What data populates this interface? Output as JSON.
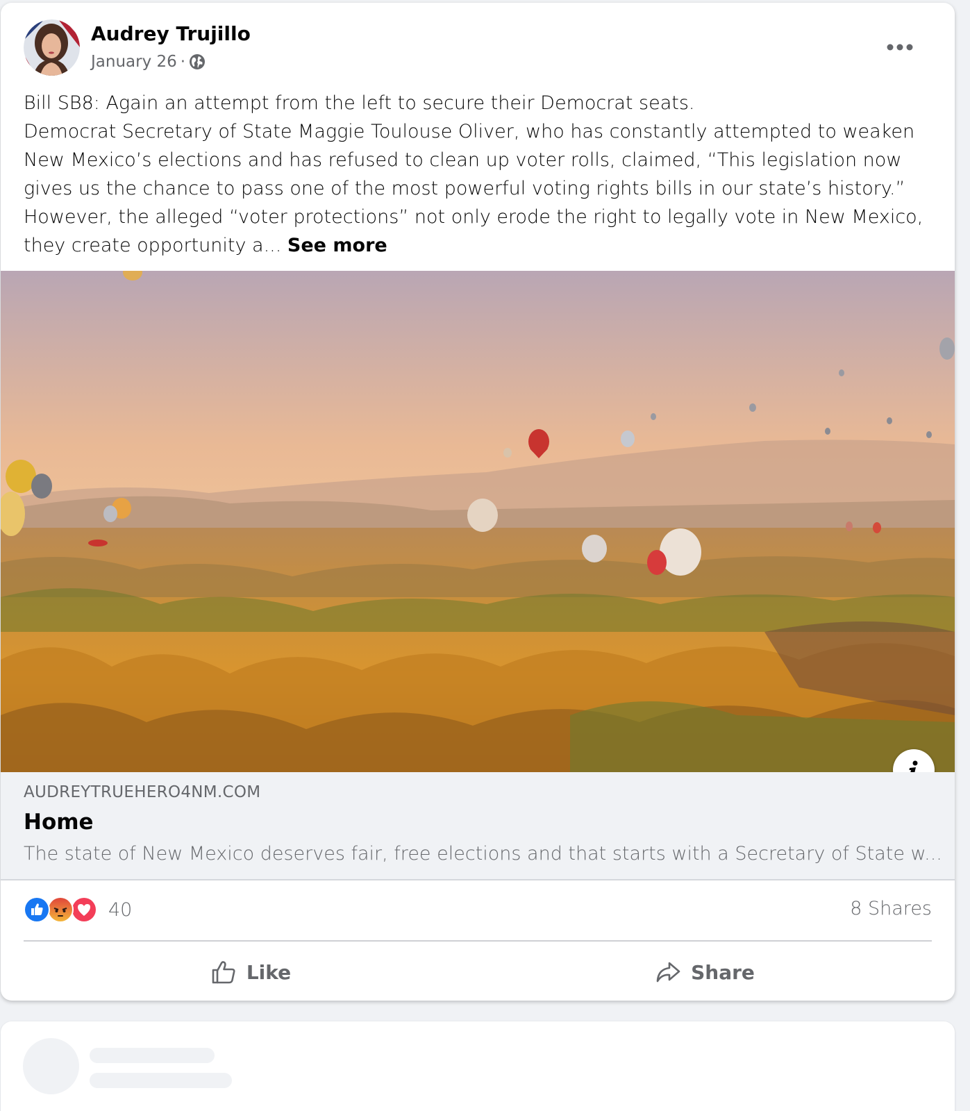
{
  "post": {
    "author": "Audrey Trujillo",
    "date": "January 26",
    "separator": "·",
    "privacy_icon": "globe-icon",
    "more_icon": "more-options-icon",
    "text_lines": [
      "Bill SB8: Again an attempt from the left to secure their Democrat seats.",
      "Democrat Secretary of State Maggie Toulouse Oliver, who has constantly attempted to weaken",
      "New Mexico’s elections and has refused to clean up voter rolls, claimed, “This legislation now",
      "gives us the chance to pass one of the most powerful voting rights bills in our state’s history.”",
      "However, the alleged “voter protections” not only erode the right to legally vote in New Mexico,",
      "they create opportunity a... "
    ],
    "see_more": "See more"
  },
  "link": {
    "domain": "AUDREYTRUEHERO4NM.COM",
    "title": "Home",
    "description": "The state of New Mexico deserves fair, free elections and that starts with a Secretary of State w...",
    "info_icon": "info-icon"
  },
  "stats": {
    "reaction_icons": [
      "like-reaction-icon",
      "angry-reaction-icon",
      "love-reaction-icon"
    ],
    "reaction_count": "40",
    "shares": "8 Shares"
  },
  "actions": {
    "like_label": "Like",
    "share_label": "Share"
  },
  "colors": {
    "text_primary": "#050505",
    "text_secondary": "#65676b",
    "like_blue": "#1877f2",
    "love_red": "#f33e58",
    "angry_orange": "#e9710f"
  }
}
